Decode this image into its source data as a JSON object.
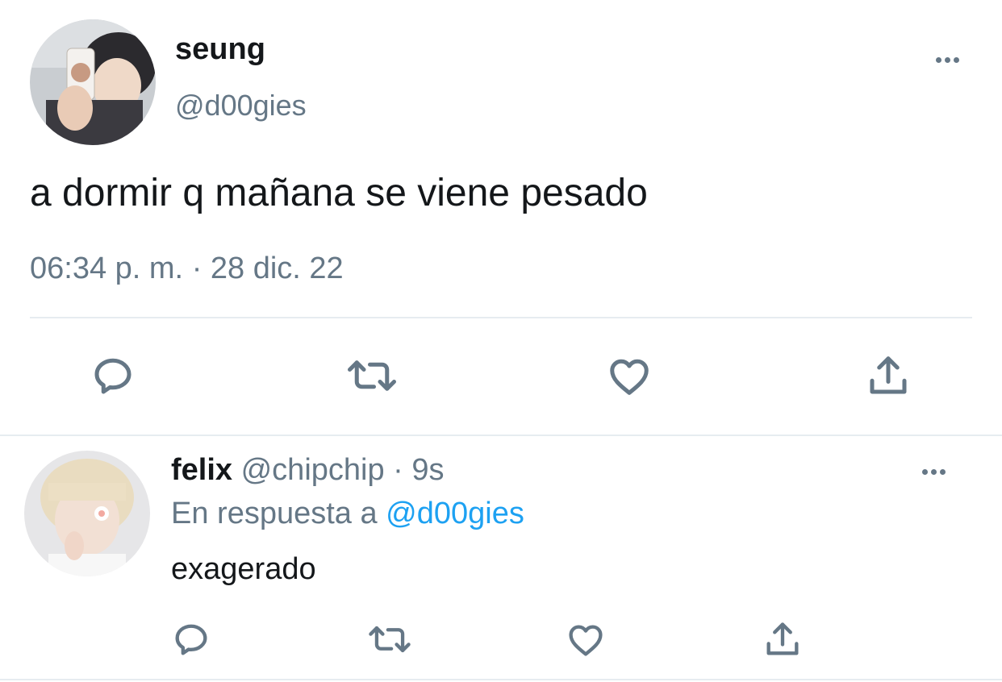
{
  "tweet": {
    "display_name": "seung",
    "handle": "@d00gies",
    "text": "a dormir q mañana se viene pesado",
    "time": "06:34 p. m.",
    "separator": "·",
    "date": "28 dic. 22",
    "actions": [
      "reply-icon",
      "retweet-icon",
      "like-icon",
      "share-icon"
    ]
  },
  "reply": {
    "display_name": "felix",
    "handle": "@chipchip",
    "separator": "·",
    "age": "9s",
    "replying_prefix": "En respuesta a",
    "replying_to": "@d00gies",
    "text": "exagerado",
    "actions": [
      "reply-icon",
      "retweet-icon",
      "like-icon",
      "share-icon"
    ]
  },
  "colors": {
    "text": "#14171a",
    "secondary": "#657786",
    "link": "#1da1f2",
    "divider": "#e6ecf0"
  }
}
